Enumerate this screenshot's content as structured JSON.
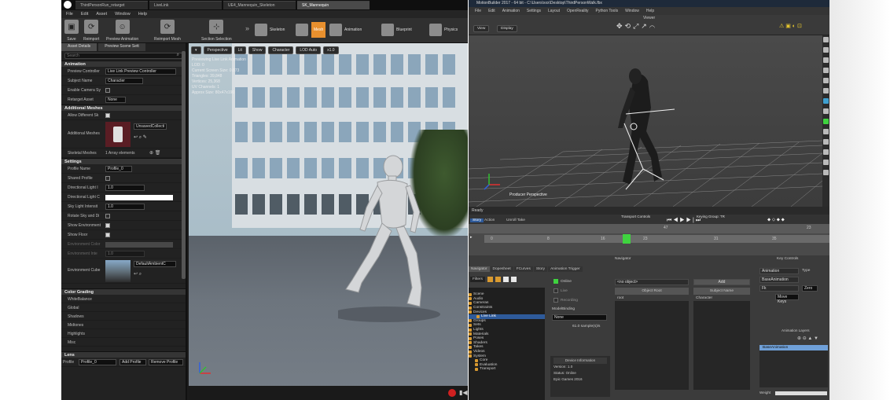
{
  "ue": {
    "tabs": [
      "ThirdPersonRun_retarget",
      "LiveLink",
      "UE4_Mannequin_Skeleton",
      "SK_Mannequin"
    ],
    "menu": [
      "File",
      "Edit",
      "Asset",
      "Window",
      "Help"
    ],
    "toolbar": {
      "save": "Save",
      "reimport": "Reimport",
      "preview_animation": "Preview Animation",
      "reimport_mesh": "Reimport Mesh",
      "section_selection": "Section Selection",
      "modes": [
        "Skeleton",
        "Mesh",
        "Animation",
        "Blueprint",
        "Physics"
      ]
    },
    "details": {
      "tab_asset_details": "Asset Details",
      "tab_preview_scene": "Preview Scene Sett",
      "search_placeholder": "Search",
      "animation_section": "Animation",
      "preview_controller_label": "Preview Controller",
      "preview_controller_value": "Live Link Preview Controller",
      "subject_name_label": "Subject Name",
      "subject_name_value": "Character",
      "enable_camera_label": "Enable Camera Sy",
      "retarget_asset_label": "Retarget Asset",
      "retarget_asset_value": "None",
      "additional_meshes_section": "Additional Meshes",
      "allow_different_label": "Allow Different Sk",
      "additional_meshes_label": "Additional Meshes",
      "unsaved_collection": "UnsavedCollecti",
      "skeletal_meshes_label": "Skeletal Meshes",
      "skeletal_meshes_value": "1 Array elements",
      "settings_section": "Settings",
      "profile_name_label": "Profile Name",
      "profile_name_value": "Profile_0",
      "shared_profile_label": "Shared Profile",
      "dir_light_int_label": "Directional Light I",
      "dir_light_int_value": "1.0",
      "dir_light_color_label": "Directional Light C",
      "sky_light_label": "Sky Light Intensit",
      "sky_light_value": "1.0",
      "rotate_sky_label": "Rotate Sky and Di",
      "show_env_label": "Show Environment",
      "show_floor_label": "Show Floor",
      "env_color_label": "Environment Color",
      "env_int_label": "Environment Inte",
      "env_int_value": "1.0",
      "env_cube_label": "Environment Cube",
      "env_cube_value": "DefaultAmbientC",
      "color_grading_section": "Color Grading",
      "color_grading_items": [
        "WhiteBalance",
        "Global",
        "Shadows",
        "Midtones",
        "Highlights",
        "Misc"
      ],
      "lens_section": "Lens",
      "profile_label": "Profile",
      "profile_value": "Profile_0",
      "add_profile": "Add Profile",
      "remove_profile": "Remove Profile"
    },
    "viewport": {
      "perspective": "Perspective",
      "lit": "Lit",
      "show": "Show",
      "character": "Character",
      "lod_auto": "LOD Auto",
      "speed": "x1.0",
      "info_lines": [
        "Previewing Live Link Animation",
        "LOD: 0",
        "Current Screen Size: 0.873",
        "Triangles: 39,848",
        "Vertices: 25,368",
        "UV Channels: 1",
        "Approx Size: 80x47x190"
      ]
    }
  },
  "mb": {
    "title": "MotionBuilder 2017 - 64 bit - C:\\Users\\xxx\\Desktop\\ThirdPersonWalk.fbx",
    "menu": [
      "File",
      "Edit",
      "Animation",
      "Settings",
      "Layout",
      "OpenReality",
      "Python Tools",
      "Window",
      "Help"
    ],
    "view_label": "Viewer",
    "view_btn": "View",
    "display_btn": "Display",
    "viewport_label": "Producer Perspective",
    "status": "Ready",
    "transport_controls": "Transport Controls",
    "keying_group": "Keying Group: TR",
    "story": "Story",
    "action": "Action",
    "take": "Unroll Take",
    "timeline_numbers": [
      "0",
      "8",
      "16",
      "23",
      "31",
      "47",
      "35",
      "23"
    ],
    "navigator_label": "Navigator",
    "key_controls_label": "Key Controls",
    "nav_tabs": [
      "Navigator",
      "Dopesheet",
      "FCurves",
      "Story",
      "Animation Trigger"
    ],
    "filters": "Filters",
    "tree": [
      "Scene",
      "Audio",
      "Cameras",
      "Constraints",
      "Devices",
      "Live Link",
      "Groups",
      "Sets",
      "Lights",
      "Materials",
      "Poses",
      "Shaders",
      "Takes",
      "Videos",
      "System",
      "Core",
      "Evaluation",
      "Transport"
    ],
    "device": {
      "online": "Online",
      "live": "Live",
      "recording": "Recording",
      "model_binding": "ModelBinding",
      "none": "None",
      "sample_rate": "61.0 sample(s)/s",
      "object_root": "Object Root",
      "subject_name": "Subject Name",
      "add": "Add",
      "no_object": "<no object>",
      "root": "root",
      "character": "Character",
      "device_info": "Device Information",
      "version": "Version: 1.0",
      "status": "Status: Online",
      "company": "Epic Games 2016"
    },
    "key_controls": {
      "animation": "Animation",
      "type": "Type",
      "base_animation": "BaseAnimation",
      "fk": "Fk",
      "zero": "Zero",
      "move_keys": "Move Keys",
      "animation_layers": "Animation Layers",
      "base_animation_layer": "BaseAnimation",
      "weight": "Weight"
    }
  },
  "colors": {
    "ue_accent": "#e8902e",
    "mb_selection": "#2e5a9a",
    "mb_online": "#3fd33f"
  }
}
